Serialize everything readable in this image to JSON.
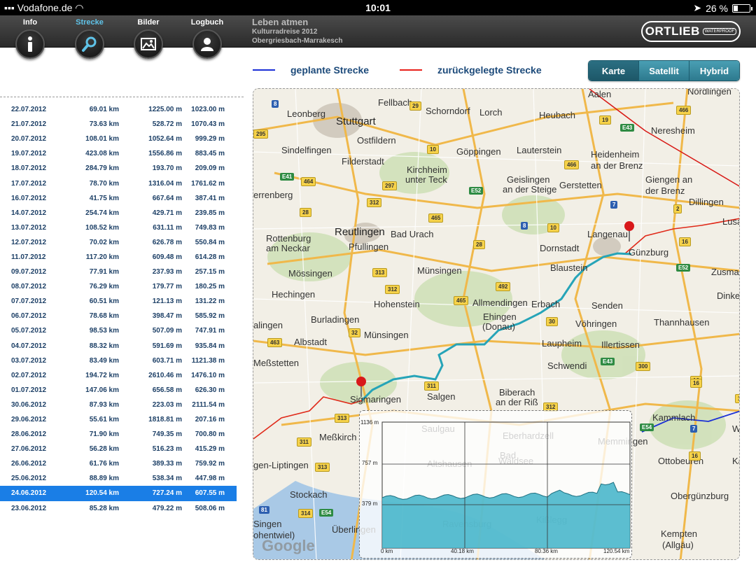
{
  "status": {
    "carrier": "Vodafone.de",
    "time": "10:01",
    "battery": "26 %"
  },
  "nav": [
    {
      "label": "Info",
      "icon": "info-icon",
      "active": false
    },
    {
      "label": "Strecke",
      "icon": "search-icon",
      "active": true
    },
    {
      "label": "Bilder",
      "icon": "pictures-icon",
      "active": false
    },
    {
      "label": "Logbuch",
      "icon": "user-icon",
      "active": false
    }
  ],
  "header": {
    "title": "Leben atmen",
    "subtitle": "Kulturradreise 2012",
    "route": "Obergriesbach-Marrakesch"
  },
  "logo": {
    "name": "ORTLIEB",
    "tag": "WATERPROOF"
  },
  "legend": {
    "planned": "geplante Strecke",
    "traveled": "zurückgelegte Strecke",
    "planned_color": "#1a2fd6",
    "traveled_color": "#e8201a"
  },
  "map_modes": [
    "Karte",
    "Satellit",
    "Hybrid"
  ],
  "log": [
    [
      "22.07.2012",
      "69.01 km",
      "1225.00 m",
      "1023.00 m"
    ],
    [
      "21.07.2012",
      "73.63 km",
      "528.72 m",
      "1070.43 m"
    ],
    [
      "20.07.2012",
      "108.01 km",
      "1052.64 m",
      "999.29 m"
    ],
    [
      "19.07.2012",
      "423.08 km",
      "1556.86 m",
      "883.45 m"
    ],
    [
      "18.07.2012",
      "284.79 km",
      "193.70 m",
      "209.09 m"
    ],
    [
      "17.07.2012",
      "78.70 km",
      "1316.04 m",
      "1761.62 m"
    ],
    [
      "16.07.2012",
      "41.75 km",
      "667.64 m",
      "387.41 m"
    ],
    [
      "14.07.2012",
      "254.74 km",
      "429.71 m",
      "239.85 m"
    ],
    [
      "13.07.2012",
      "108.52 km",
      "631.11 m",
      "749.83 m"
    ],
    [
      "12.07.2012",
      "70.02 km",
      "626.78 m",
      "550.84 m"
    ],
    [
      "11.07.2012",
      "117.20 km",
      "609.48 m",
      "614.28 m"
    ],
    [
      "09.07.2012",
      "77.91 km",
      "237.93 m",
      "257.15 m"
    ],
    [
      "08.07.2012",
      "76.29 km",
      "179.77 m",
      "180.25 m"
    ],
    [
      "07.07.2012",
      "60.51 km",
      "121.13 m",
      "131.22 m"
    ],
    [
      "06.07.2012",
      "78.68 km",
      "398.47 m",
      "585.92 m"
    ],
    [
      "05.07.2012",
      "98.53 km",
      "507.09 m",
      "747.91 m"
    ],
    [
      "04.07.2012",
      "88.32 km",
      "591.69 m",
      "935.84 m"
    ],
    [
      "03.07.2012",
      "83.49 km",
      "603.71 m",
      "1121.38 m"
    ],
    [
      "02.07.2012",
      "194.72 km",
      "2610.46 m",
      "1476.10 m"
    ],
    [
      "01.07.2012",
      "147.06 km",
      "656.58 m",
      "626.30 m"
    ],
    [
      "30.06.2012",
      "87.93 km",
      "223.03 m",
      "2111.54 m"
    ],
    [
      "29.06.2012",
      "55.61 km",
      "1818.81 m",
      "207.16 m"
    ],
    [
      "28.06.2012",
      "71.90 km",
      "749.35 m",
      "700.80 m"
    ],
    [
      "27.06.2012",
      "56.28 km",
      "516.23 m",
      "415.29 m"
    ],
    [
      "26.06.2012",
      "61.76 km",
      "389.33 m",
      "759.92 m"
    ],
    [
      "25.06.2012",
      "88.89 km",
      "538.34 m",
      "447.98 m"
    ],
    [
      "24.06.2012",
      "120.54 km",
      "727.24 m",
      "607.55 m"
    ],
    [
      "23.06.2012",
      "85.28 km",
      "479.22 m",
      "508.06 m"
    ]
  ],
  "selected_index": 26,
  "map": {
    "cities": [
      "Aalen",
      "Nördlingen",
      "Fellbach",
      "Schorndorf",
      "Lorch",
      "Heubach",
      "Leonberg",
      "Stuttgart",
      "Neresheim",
      "Ostfildern",
      "Sindelfingen",
      "Göppingen",
      "Lauterstein",
      "Heidenheim",
      "an der Brenz",
      "Filderstadt",
      "Kirchheim",
      "unter Teck",
      "Geislingen",
      "an der Steige",
      "Gerstetten",
      "Giengen an",
      "der Brenz",
      "errenberg",
      "Dillingen",
      "Reutlingen",
      "Bad Urach",
      "Langenau",
      "Lusa",
      "Rottenburg",
      "am Neckar",
      "Pfullingen",
      "Dornstadt",
      "Günzburg",
      "Blaustein",
      "Zusmarsh",
      "Mössingen",
      "Münsingen",
      "Hechingen",
      "Dinkelsch",
      "Allmendingen",
      "Erbach",
      "Senden",
      "Hohenstein",
      "Ehingen",
      "(Donau)",
      "Burladingen",
      "Vöhringen",
      "Thannhausen",
      "alingen",
      "Münsingen",
      "Laupheim",
      "Albstadt",
      "Illertissen",
      "Meßstetten",
      "Schwendi",
      "Biberach",
      "an der Riß",
      "Salgen",
      "Sigmaringen",
      "Meßkirch",
      "Kammlach",
      "Bad",
      "Wörishe",
      "Kaufb",
      "gen-Liptingen",
      "Stockach",
      "Obergünzburg",
      "Singen",
      "ohentwiel)",
      "Überlingen",
      "Kempten",
      "(Allgäu)",
      "Memmingen",
      "Ottobeuren",
      "Saulgau",
      "Eberhardzell",
      "Altshausen",
      "Waldsee",
      "Ravensburg",
      "Kißlegg"
    ],
    "roads": [
      "8",
      "29",
      "466",
      "19",
      "295",
      "E43",
      "10",
      "E41",
      "464",
      "466",
      "297",
      "312",
      "E52",
      "7",
      "465",
      "28",
      "8",
      "10",
      "2",
      "313",
      "312",
      "492",
      "28",
      "E52",
      "465",
      "30",
      "32",
      "16",
      "463",
      "E43",
      "300",
      "16",
      "311",
      "312",
      "16",
      "313",
      "E54",
      "311",
      "313",
      "81",
      "314",
      "E54",
      "7",
      "16",
      "16"
    ],
    "google": "Google"
  },
  "profile": {
    "y_ticks": [
      "1136 m",
      "757 m",
      "379 m"
    ],
    "x_ticks": [
      "0 km",
      "40.18 km",
      "80.36 km",
      "120.54 km"
    ],
    "fill_color": "#3fb3c8"
  }
}
